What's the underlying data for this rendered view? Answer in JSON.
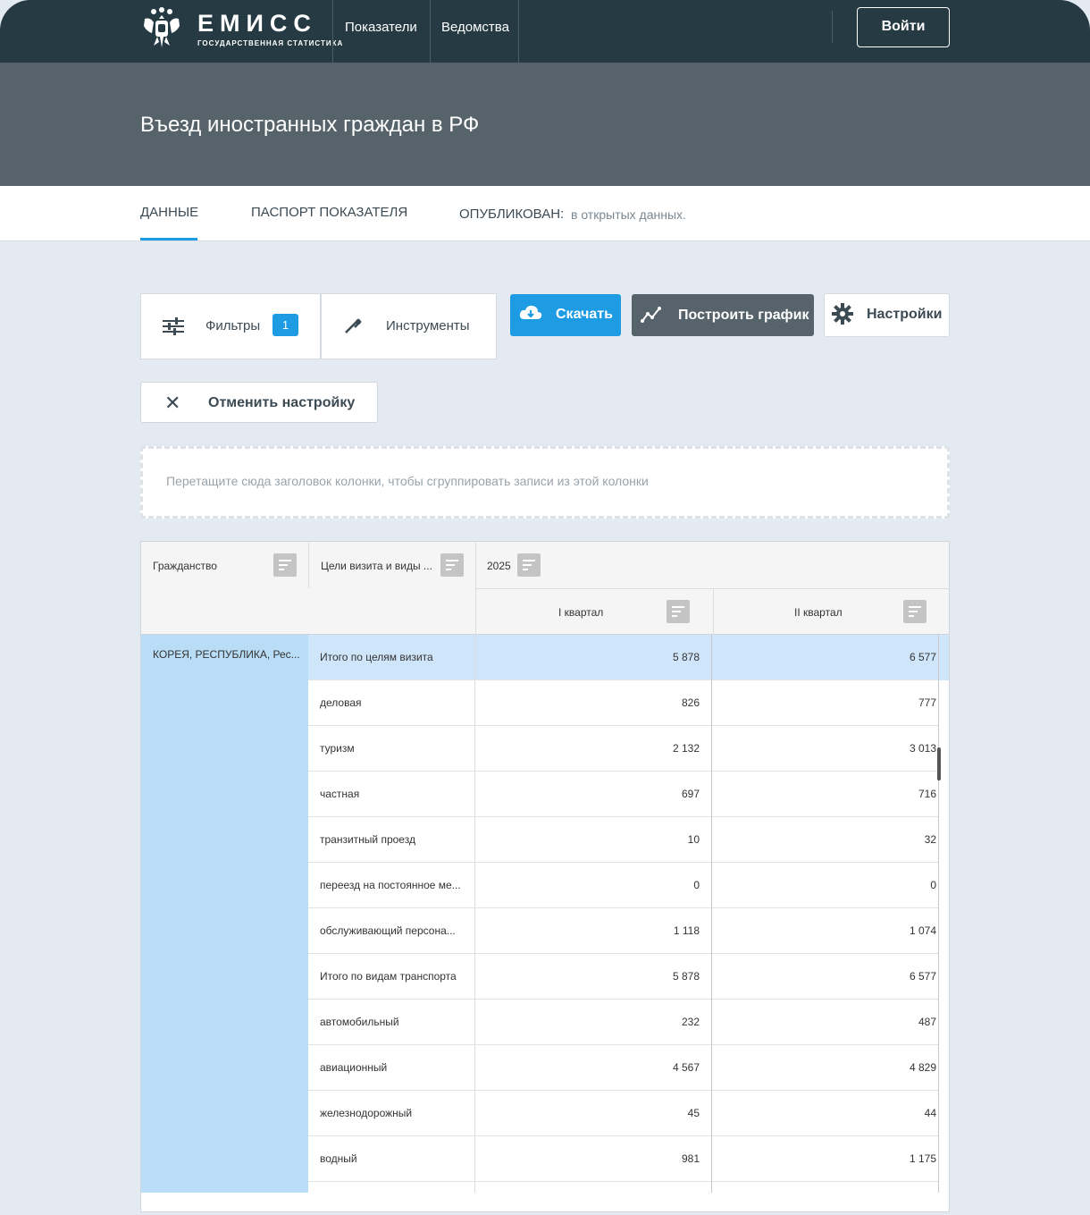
{
  "brand": {
    "title": "ЕМИСС",
    "subtitle": "ГОСУДАРСТВЕННАЯ СТАТИСТИКА",
    "logo_icon": "coat-of-arms-icon"
  },
  "nav": {
    "items": [
      "Показатели",
      "Ведомства"
    ],
    "login_label": "Войти"
  },
  "page": {
    "title": "Въезд иностранных граждан в РФ"
  },
  "tabs": {
    "data": "Данные",
    "passport": "Паспорт показателя",
    "published_label": "Опубликован:",
    "published_value": "в открытых данных."
  },
  "toolbar": {
    "filters_label": "Фильтры",
    "filters_count": "1",
    "tools_label": "Инструменты",
    "download_label": "Скачать",
    "chart_label": "Построить график",
    "settings_label": "Настройки",
    "reset_label": "Отменить настройку"
  },
  "group_zone": {
    "hint": "Перетащите сюда заголовок колонки, чтобы сгруппировать записи из этой колонки"
  },
  "grid": {
    "headers": {
      "citizenship": "Гражданство",
      "purpose": "Цели визита и виды ...",
      "year": "2025",
      "q1": "I квартал",
      "q2": "II квартал"
    },
    "country": "КОРЕЯ, РЕСПУБЛИКА, Рес...",
    "rows": [
      {
        "label": "Итого по целям визита",
        "q1": "5 878",
        "q2": "6 577"
      },
      {
        "label": "деловая",
        "q1": "826",
        "q2": "777"
      },
      {
        "label": "туризм",
        "q1": "2 132",
        "q2": "3 013"
      },
      {
        "label": "частная",
        "q1": "697",
        "q2": "716"
      },
      {
        "label": "транзитный проезд",
        "q1": "10",
        "q2": "32"
      },
      {
        "label": "переезд на постоянное ме...",
        "q1": "0",
        "q2": "0"
      },
      {
        "label": "обслуживающий персона...",
        "q1": "1 118",
        "q2": "1 074"
      },
      {
        "label": "Итого по видам транспорта",
        "q1": "5 878",
        "q2": "6 577"
      },
      {
        "label": "автомобильный",
        "q1": "232",
        "q2": "487"
      },
      {
        "label": "авиационный",
        "q1": "4 567",
        "q2": "4 829"
      },
      {
        "label": "железнодорожный",
        "q1": "45",
        "q2": "44"
      },
      {
        "label": "водный",
        "q1": "981",
        "q2": "1 175"
      }
    ]
  },
  "colors": {
    "topbar": "#253a43",
    "header": "#57636b",
    "accent": "#1d9be3",
    "row_highlight": "#cfe6fa",
    "country_cell": "#b9ddf6"
  }
}
